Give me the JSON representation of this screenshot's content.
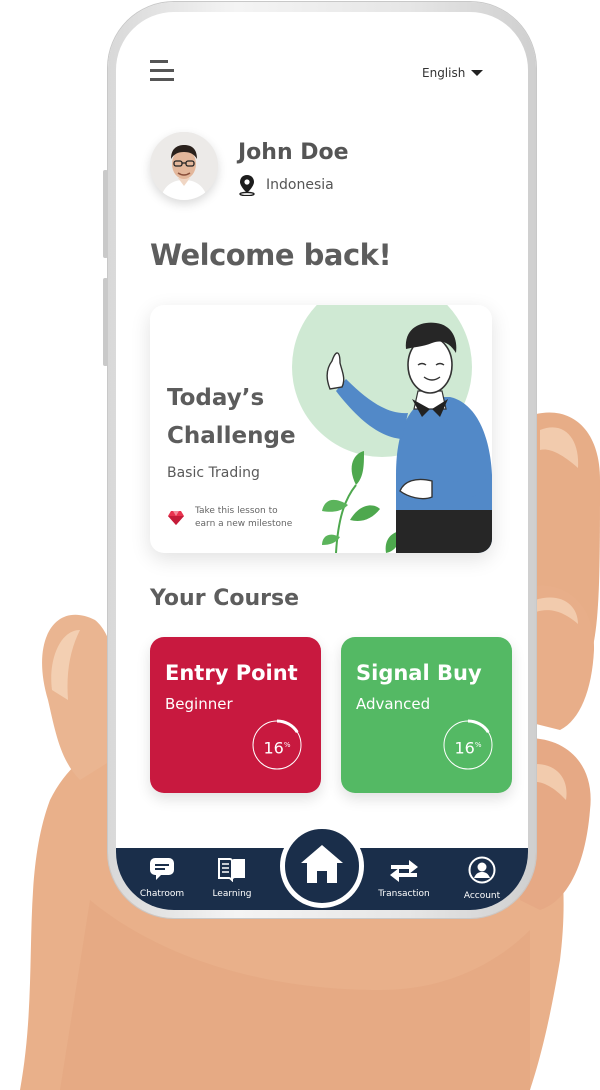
{
  "header": {
    "language": "English"
  },
  "profile": {
    "name": "John Doe",
    "location": "Indonesia"
  },
  "welcome": "Welcome back!",
  "challenge": {
    "title_line1": "Today’s",
    "title_line2": "Challenge",
    "subtitle": "Basic Trading",
    "note_line1": "Take this lesson to",
    "note_line2": "earn a new milestone"
  },
  "courses": {
    "heading": "Your Course",
    "items": [
      {
        "title": "Entry Point",
        "level": "Beginner",
        "progress": "16",
        "progress_unit": "%",
        "progress_value": 0.16,
        "color": "#c8193f"
      },
      {
        "title": "Signal Buy",
        "level": "Advanced",
        "progress": "16",
        "progress_unit": "%",
        "progress_value": 0.16,
        "color": "#54b964"
      }
    ]
  },
  "nav": {
    "items": [
      {
        "label": "Chatroom",
        "icon": "chat-icon"
      },
      {
        "label": "Learning",
        "icon": "book-icon"
      },
      {
        "label": "Transaction",
        "icon": "transfer-icon"
      },
      {
        "label": "Account",
        "icon": "account-icon"
      }
    ],
    "home_icon": "home-icon"
  },
  "colors": {
    "nav_bg": "#1a2e4a",
    "card_red": "#c8193f",
    "card_green": "#54b964",
    "accent_green": "#cfe9d3"
  }
}
